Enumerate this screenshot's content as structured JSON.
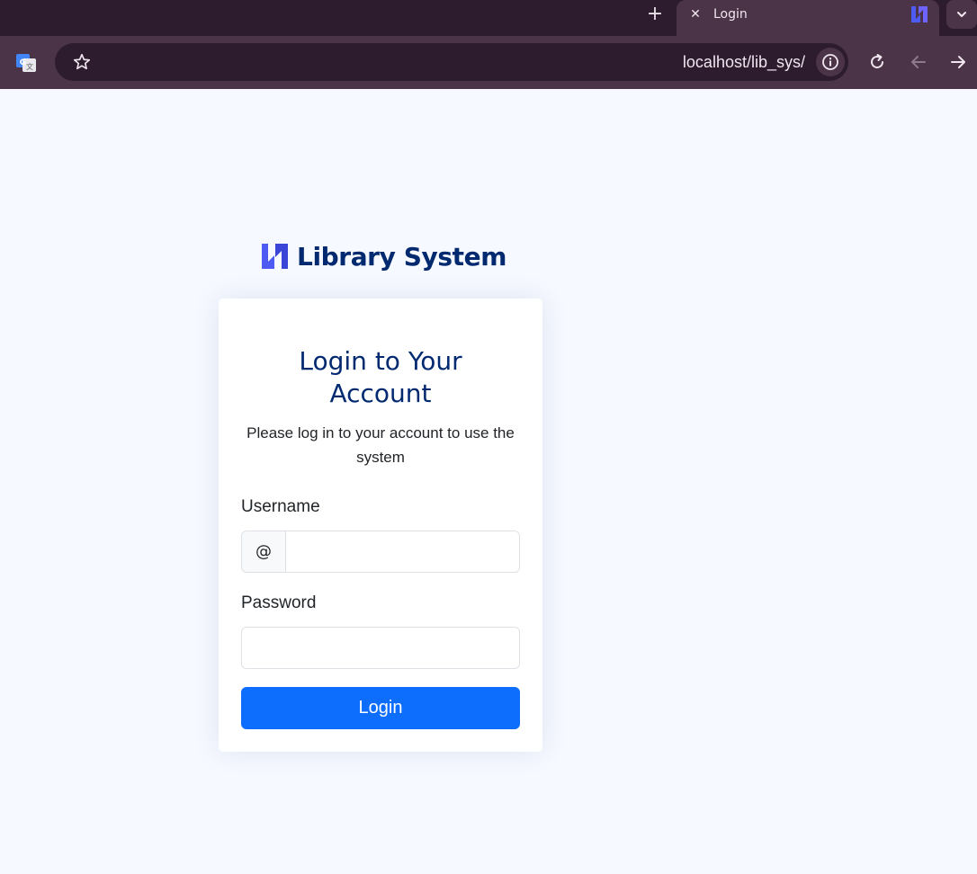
{
  "browser": {
    "tab": {
      "title": "Login",
      "close_glyph": "✕"
    },
    "new_tab_glyph": "+",
    "url": "localhost/lib_sys/",
    "icons": [
      "translate-icon",
      "star-icon",
      "info-icon",
      "reload-icon",
      "back-icon",
      "forward-icon",
      "tab-dropdown-icon",
      "favicon"
    ]
  },
  "page": {
    "brand": "Library System",
    "brand_color": "#012970",
    "card_title": "Login to Your Account",
    "card_subtitle": "Please log in to your account to use the system",
    "username_label": "Username",
    "username_addon": "@",
    "username_value": "",
    "password_label": "Password",
    "password_value": "",
    "login_button": "Login",
    "accent_color": "#0d6efd"
  }
}
